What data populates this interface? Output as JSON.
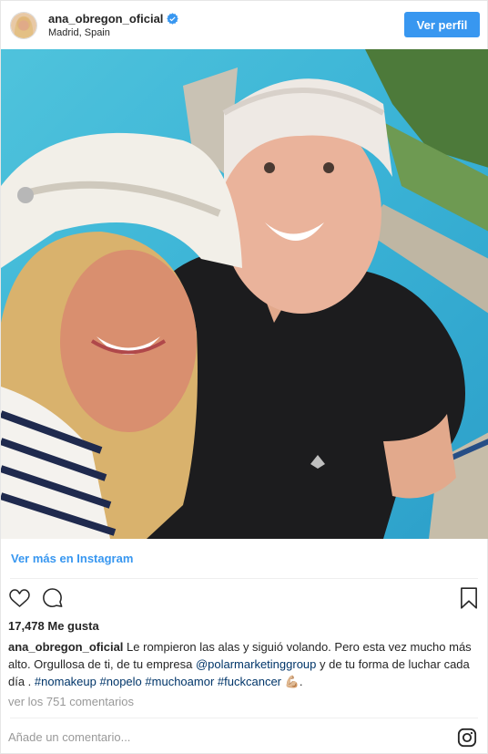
{
  "header": {
    "username": "ana_obregon_oficial",
    "location": "Madrid, Spain",
    "view_profile_label": "Ver perfil"
  },
  "link": {
    "more_label": "Ver más en Instagram"
  },
  "stats": {
    "likes": "17,478 Me gusta"
  },
  "caption": {
    "username": "ana_obregon_oficial",
    "text_1": "Le rompieron las alas y siguió volando. Pero esta vez mucho más alto. Orgullosa de ti, de tu empresa ",
    "mention": "@polarmarketinggroup",
    "text_2": " y de tu forma de luchar cada día . ",
    "tag_1": "#nomakeup",
    "tag_2": "#nopelo",
    "tag_3": "#muchoamor",
    "tag_4": "#fuckcancer",
    "emoji": "💪🏼",
    "end": "."
  },
  "comments": {
    "view_all_label": "ver los 751 comentarios",
    "placeholder": "Añade un comentario..."
  },
  "colors": {
    "accent": "#3897f0",
    "hashtag": "#003569",
    "muted": "#999999"
  },
  "icons": {
    "verified": "verified-badge-icon",
    "like": "heart-icon",
    "comment": "comment-icon",
    "save": "bookmark-icon",
    "instagram": "instagram-logo-icon"
  }
}
